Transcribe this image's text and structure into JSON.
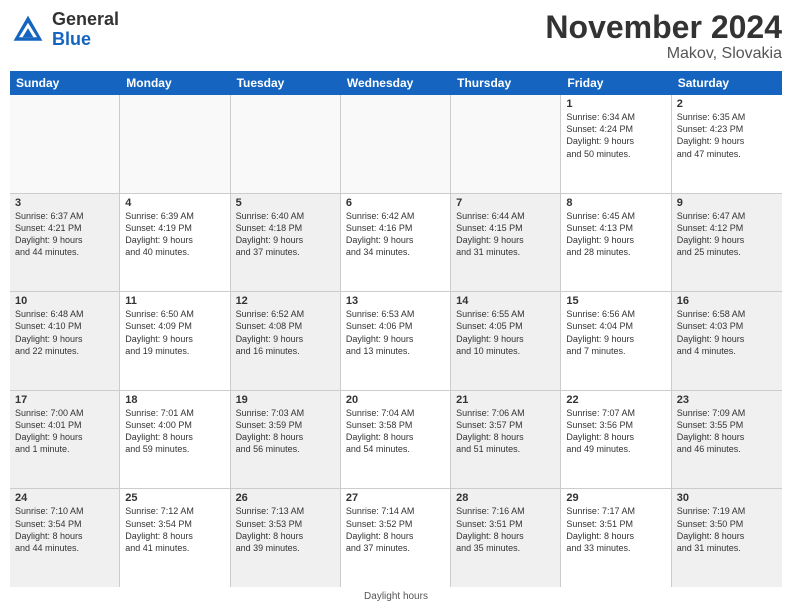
{
  "logo": {
    "general": "General",
    "blue": "Blue"
  },
  "title": "November 2024",
  "location": "Makov, Slovakia",
  "days": [
    "Sunday",
    "Monday",
    "Tuesday",
    "Wednesday",
    "Thursday",
    "Friday",
    "Saturday"
  ],
  "footer": "Daylight hours",
  "weeks": [
    [
      {
        "day": "",
        "empty": true
      },
      {
        "day": "",
        "empty": true
      },
      {
        "day": "",
        "empty": true
      },
      {
        "day": "",
        "empty": true
      },
      {
        "day": "",
        "empty": true
      },
      {
        "day": "1",
        "info": "Sunrise: 6:34 AM\nSunset: 4:24 PM\nDaylight: 9 hours\nand 50 minutes."
      },
      {
        "day": "2",
        "info": "Sunrise: 6:35 AM\nSunset: 4:23 PM\nDaylight: 9 hours\nand 47 minutes."
      }
    ],
    [
      {
        "day": "3",
        "info": "Sunrise: 6:37 AM\nSunset: 4:21 PM\nDaylight: 9 hours\nand 44 minutes.",
        "shaded": true
      },
      {
        "day": "4",
        "info": "Sunrise: 6:39 AM\nSunset: 4:19 PM\nDaylight: 9 hours\nand 40 minutes."
      },
      {
        "day": "5",
        "info": "Sunrise: 6:40 AM\nSunset: 4:18 PM\nDaylight: 9 hours\nand 37 minutes.",
        "shaded": true
      },
      {
        "day": "6",
        "info": "Sunrise: 6:42 AM\nSunset: 4:16 PM\nDaylight: 9 hours\nand 34 minutes."
      },
      {
        "day": "7",
        "info": "Sunrise: 6:44 AM\nSunset: 4:15 PM\nDaylight: 9 hours\nand 31 minutes.",
        "shaded": true
      },
      {
        "day": "8",
        "info": "Sunrise: 6:45 AM\nSunset: 4:13 PM\nDaylight: 9 hours\nand 28 minutes."
      },
      {
        "day": "9",
        "info": "Sunrise: 6:47 AM\nSunset: 4:12 PM\nDaylight: 9 hours\nand 25 minutes.",
        "shaded": true
      }
    ],
    [
      {
        "day": "10",
        "info": "Sunrise: 6:48 AM\nSunset: 4:10 PM\nDaylight: 9 hours\nand 22 minutes.",
        "shaded": true
      },
      {
        "day": "11",
        "info": "Sunrise: 6:50 AM\nSunset: 4:09 PM\nDaylight: 9 hours\nand 19 minutes."
      },
      {
        "day": "12",
        "info": "Sunrise: 6:52 AM\nSunset: 4:08 PM\nDaylight: 9 hours\nand 16 minutes.",
        "shaded": true
      },
      {
        "day": "13",
        "info": "Sunrise: 6:53 AM\nSunset: 4:06 PM\nDaylight: 9 hours\nand 13 minutes."
      },
      {
        "day": "14",
        "info": "Sunrise: 6:55 AM\nSunset: 4:05 PM\nDaylight: 9 hours\nand 10 minutes.",
        "shaded": true
      },
      {
        "day": "15",
        "info": "Sunrise: 6:56 AM\nSunset: 4:04 PM\nDaylight: 9 hours\nand 7 minutes."
      },
      {
        "day": "16",
        "info": "Sunrise: 6:58 AM\nSunset: 4:03 PM\nDaylight: 9 hours\nand 4 minutes.",
        "shaded": true
      }
    ],
    [
      {
        "day": "17",
        "info": "Sunrise: 7:00 AM\nSunset: 4:01 PM\nDaylight: 9 hours\nand 1 minute.",
        "shaded": true
      },
      {
        "day": "18",
        "info": "Sunrise: 7:01 AM\nSunset: 4:00 PM\nDaylight: 8 hours\nand 59 minutes."
      },
      {
        "day": "19",
        "info": "Sunrise: 7:03 AM\nSunset: 3:59 PM\nDaylight: 8 hours\nand 56 minutes.",
        "shaded": true
      },
      {
        "day": "20",
        "info": "Sunrise: 7:04 AM\nSunset: 3:58 PM\nDaylight: 8 hours\nand 54 minutes."
      },
      {
        "day": "21",
        "info": "Sunrise: 7:06 AM\nSunset: 3:57 PM\nDaylight: 8 hours\nand 51 minutes.",
        "shaded": true
      },
      {
        "day": "22",
        "info": "Sunrise: 7:07 AM\nSunset: 3:56 PM\nDaylight: 8 hours\nand 49 minutes."
      },
      {
        "day": "23",
        "info": "Sunrise: 7:09 AM\nSunset: 3:55 PM\nDaylight: 8 hours\nand 46 minutes.",
        "shaded": true
      }
    ],
    [
      {
        "day": "24",
        "info": "Sunrise: 7:10 AM\nSunset: 3:54 PM\nDaylight: 8 hours\nand 44 minutes.",
        "shaded": true
      },
      {
        "day": "25",
        "info": "Sunrise: 7:12 AM\nSunset: 3:54 PM\nDaylight: 8 hours\nand 41 minutes."
      },
      {
        "day": "26",
        "info": "Sunrise: 7:13 AM\nSunset: 3:53 PM\nDaylight: 8 hours\nand 39 minutes.",
        "shaded": true
      },
      {
        "day": "27",
        "info": "Sunrise: 7:14 AM\nSunset: 3:52 PM\nDaylight: 8 hours\nand 37 minutes."
      },
      {
        "day": "28",
        "info": "Sunrise: 7:16 AM\nSunset: 3:51 PM\nDaylight: 8 hours\nand 35 minutes.",
        "shaded": true
      },
      {
        "day": "29",
        "info": "Sunrise: 7:17 AM\nSunset: 3:51 PM\nDaylight: 8 hours\nand 33 minutes."
      },
      {
        "day": "30",
        "info": "Sunrise: 7:19 AM\nSunset: 3:50 PM\nDaylight: 8 hours\nand 31 minutes.",
        "shaded": true
      }
    ]
  ]
}
